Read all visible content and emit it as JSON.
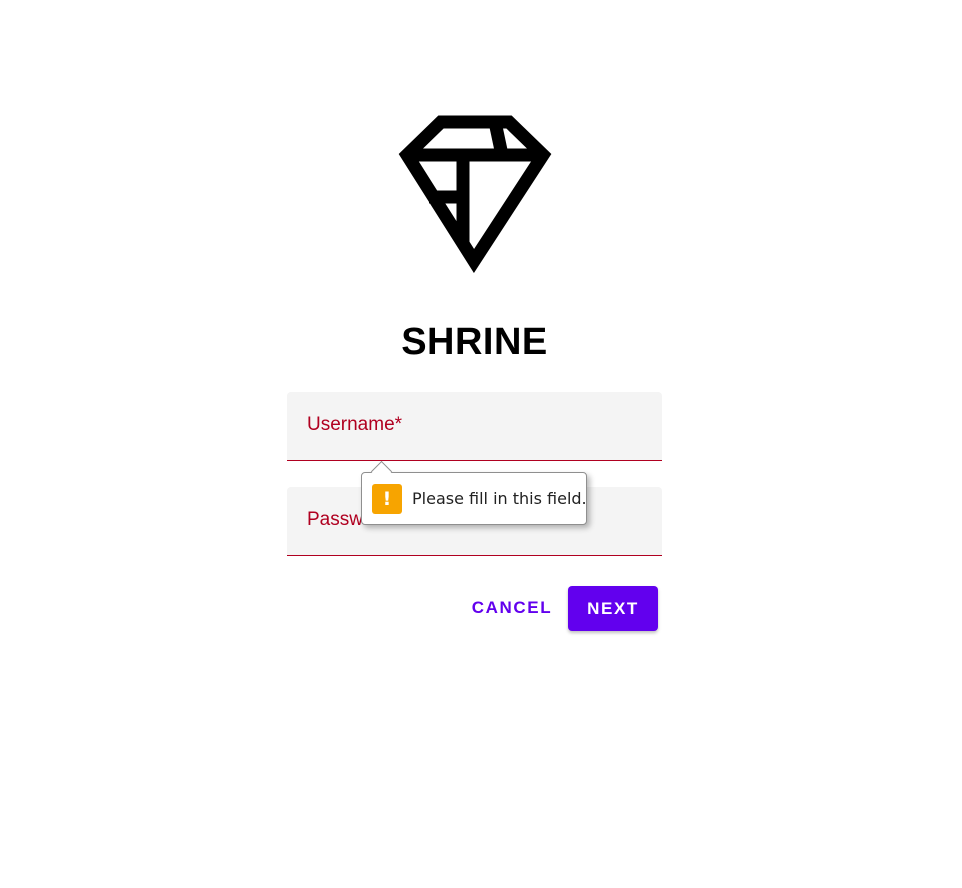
{
  "brand": {
    "title": "SHRINE",
    "logo_icon": "diamond-logo-icon"
  },
  "form": {
    "username": {
      "label": "Username*",
      "value": ""
    },
    "password": {
      "label": "Password",
      "value": ""
    }
  },
  "validation_tooltip": {
    "icon": "warning-icon",
    "icon_glyph": "!",
    "message": "Please fill in this field."
  },
  "actions": {
    "cancel_label": "CANCEL",
    "next_label": "NEXT"
  },
  "colors": {
    "primary": "#6200ee",
    "error": "#b00020",
    "warning": "#f7a400",
    "field_background": "#f4f4f4"
  }
}
